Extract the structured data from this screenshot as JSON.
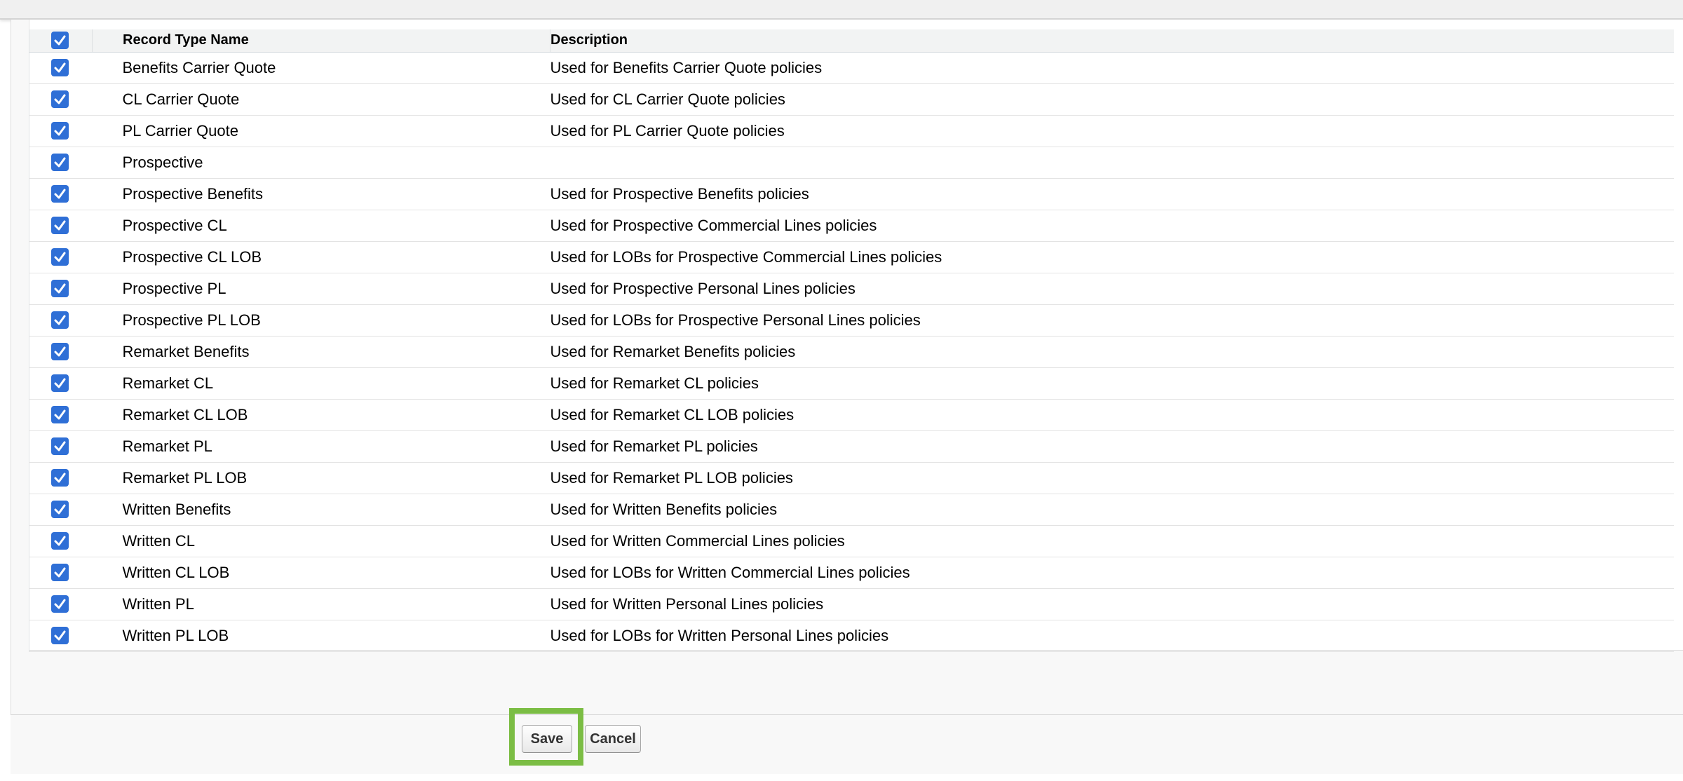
{
  "table": {
    "headers": {
      "select_all_checked": true,
      "name": "Record Type Name",
      "description": "Description"
    },
    "rows": [
      {
        "checked": true,
        "name": "Benefits Carrier Quote",
        "description": "Used for Benefits Carrier Quote policies"
      },
      {
        "checked": true,
        "name": "CL Carrier Quote",
        "description": "Used for CL Carrier Quote policies"
      },
      {
        "checked": true,
        "name": "PL Carrier Quote",
        "description": "Used for PL Carrier Quote policies"
      },
      {
        "checked": true,
        "name": "Prospective",
        "description": ""
      },
      {
        "checked": true,
        "name": "Prospective Benefits",
        "description": "Used for Prospective Benefits policies"
      },
      {
        "checked": true,
        "name": "Prospective CL",
        "description": "Used for Prospective Commercial Lines policies"
      },
      {
        "checked": true,
        "name": "Prospective CL LOB",
        "description": "Used for LOBs for Prospective Commercial Lines policies"
      },
      {
        "checked": true,
        "name": "Prospective PL",
        "description": "Used for Prospective Personal Lines policies"
      },
      {
        "checked": true,
        "name": "Prospective PL LOB",
        "description": "Used for LOBs for Prospective Personal Lines policies"
      },
      {
        "checked": true,
        "name": "Remarket Benefits",
        "description": "Used for Remarket Benefits policies"
      },
      {
        "checked": true,
        "name": "Remarket CL",
        "description": "Used for Remarket CL policies"
      },
      {
        "checked": true,
        "name": "Remarket CL LOB",
        "description": "Used for Remarket CL LOB policies"
      },
      {
        "checked": true,
        "name": "Remarket PL",
        "description": "Used for Remarket PL policies"
      },
      {
        "checked": true,
        "name": "Remarket PL LOB",
        "description": "Used for Remarket PL LOB policies"
      },
      {
        "checked": true,
        "name": "Written Benefits",
        "description": "Used for Written Benefits policies"
      },
      {
        "checked": true,
        "name": "Written CL",
        "description": "Used for Written Commercial Lines policies"
      },
      {
        "checked": true,
        "name": "Written CL LOB",
        "description": "Used for LOBs for Written Commercial Lines policies"
      },
      {
        "checked": true,
        "name": "Written PL",
        "description": "Used for Written Personal Lines policies"
      },
      {
        "checked": true,
        "name": "Written PL LOB",
        "description": "Used for LOBs for Written Personal Lines policies"
      }
    ]
  },
  "buttons": {
    "save_label": "Save",
    "cancel_label": "Cancel"
  },
  "colors": {
    "checkbox": "#2f6fd6",
    "highlight": "#7bbd44",
    "header_bg": "#f2f3f3"
  },
  "icons": {
    "checkbox": "checkbox-checked-icon"
  }
}
